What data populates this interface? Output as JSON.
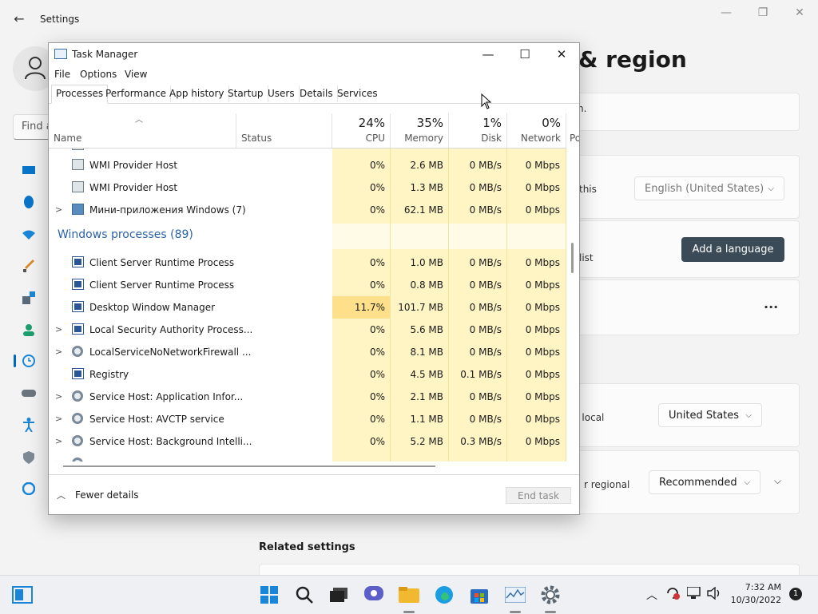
{
  "settings": {
    "title": "Settings",
    "find_placeholder": "Find a",
    "heading": "& region",
    "partial_line_1": "n.",
    "partial_line_2": "this",
    "display_language_value": "English (United States)",
    "preferred_languages_partial": "list",
    "add_language_label": "Add a language",
    "more_label": "...",
    "country_partial": "u local",
    "country_value": "United States",
    "regional_partial": "r regional",
    "regional_value": "Recommended",
    "related_settings": "Related settings"
  },
  "task_manager": {
    "title": "Task Manager",
    "menu": [
      "File",
      "Options",
      "View"
    ],
    "tabs": [
      "Processes",
      "Performance",
      "App history",
      "Startup",
      "Users",
      "Details",
      "Services"
    ],
    "columns": {
      "name": "Name",
      "status": "Status",
      "cpu_pct": "24%",
      "cpu": "CPU",
      "memory_pct": "35%",
      "memory": "Memory",
      "disk_pct": "1%",
      "disk": "Disk",
      "network_pct": "0%",
      "network": "Network",
      "power_partial": "Po"
    },
    "rows_apps": [
      {
        "name": "WMI Provider Host",
        "cpu": "0%",
        "memory": "2.6 MB",
        "disk": "0 MB/s",
        "network": "0 Mbps"
      },
      {
        "name": "WMI Provider Host",
        "cpu": "0%",
        "memory": "1.3 MB",
        "disk": "0 MB/s",
        "network": "0 Mbps"
      },
      {
        "name": "Мини-приложения Windows (7)",
        "cpu": "0%",
        "memory": "62.1 MB",
        "disk": "0 MB/s",
        "network": "0 Mbps"
      }
    ],
    "group_label": "Windows processes (89)",
    "rows_windows": [
      {
        "name": "Client Server Runtime Process",
        "cpu": "0%",
        "memory": "1.0 MB",
        "disk": "0 MB/s",
        "network": "0 Mbps"
      },
      {
        "name": "Client Server Runtime Process",
        "cpu": "0%",
        "memory": "0.8 MB",
        "disk": "0 MB/s",
        "network": "0 Mbps"
      },
      {
        "name": "Desktop Window Manager",
        "cpu": "11.7%",
        "memory": "101.7 MB",
        "disk": "0 MB/s",
        "network": "0 Mbps"
      },
      {
        "name": "Local Security Authority Process...",
        "cpu": "0%",
        "memory": "5.6 MB",
        "disk": "0 MB/s",
        "network": "0 Mbps"
      },
      {
        "name": "LocalServiceNoNetworkFirewall ...",
        "cpu": "0%",
        "memory": "8.1 MB",
        "disk": "0 MB/s",
        "network": "0 Mbps"
      },
      {
        "name": "Registry",
        "cpu": "0%",
        "memory": "4.5 MB",
        "disk": "0.1 MB/s",
        "network": "0 Mbps"
      },
      {
        "name": "Service Host: Application Infor...",
        "cpu": "0%",
        "memory": "2.1 MB",
        "disk": "0 MB/s",
        "network": "0 Mbps"
      },
      {
        "name": "Service Host: AVCTP service",
        "cpu": "0%",
        "memory": "1.1 MB",
        "disk": "0 MB/s",
        "network": "0 Mbps"
      },
      {
        "name": "Service Host: Background Intelli...",
        "cpu": "0%",
        "memory": "5.2 MB",
        "disk": "0.3 MB/s",
        "network": "0 Mbps"
      }
    ],
    "fewer_details": "Fewer details",
    "end_task": "End task"
  },
  "taskbar": {
    "time": "7:32 AM",
    "date": "10/30/2022",
    "notification_count": "1"
  },
  "colors": {
    "accent": "#0067c0",
    "heat_low": "#fff4c4",
    "heat_high": "#ffe08a",
    "group_title": "#2a62a9"
  }
}
